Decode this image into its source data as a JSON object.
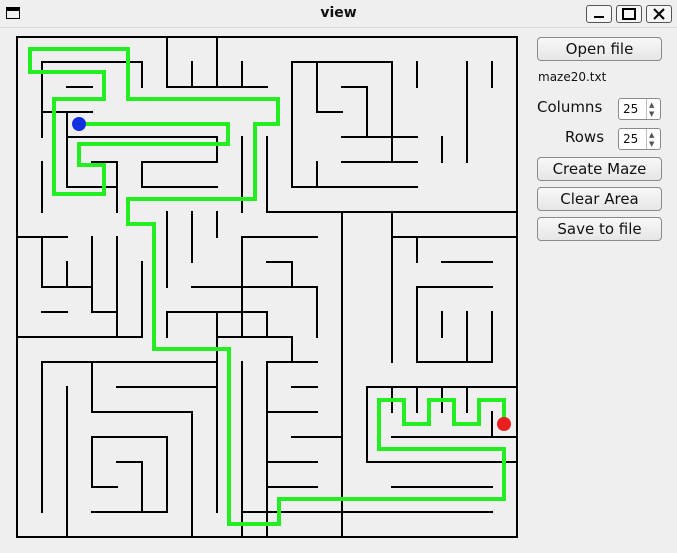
{
  "window": {
    "title": "view"
  },
  "sidebar": {
    "open_file_label": "Open file",
    "file_name": "maze20.txt",
    "columns_label": "Columns",
    "columns_value": "25",
    "rows_label": "Rows",
    "rows_value": "25",
    "create_maze_label": "Create Maze",
    "clear_area_label": "Clear Area",
    "save_file_label": "Save to file"
  },
  "maze": {
    "wall_color": "#000000",
    "path_color": "#22ee22",
    "start_marker_color": "#1030e0",
    "end_marker_color": "#e82020"
  }
}
